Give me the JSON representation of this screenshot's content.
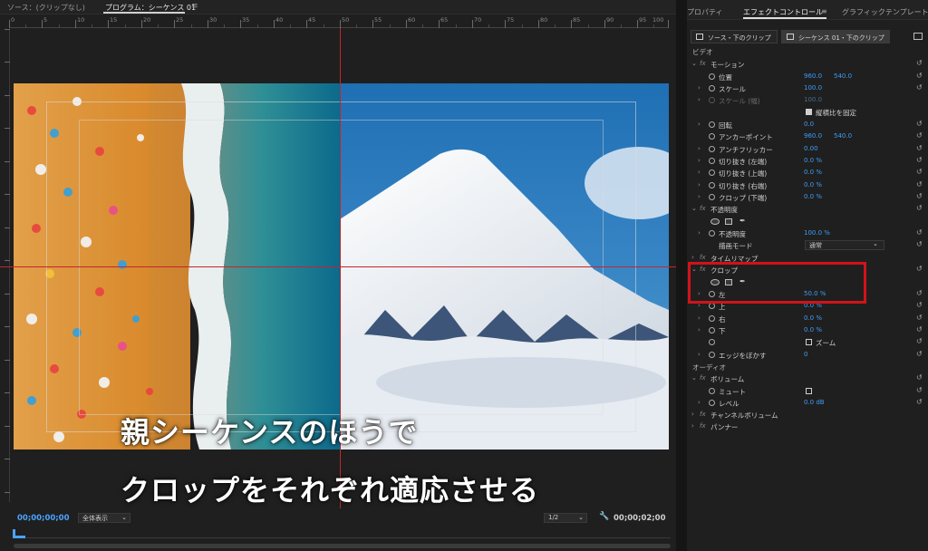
{
  "monitor": {
    "source_tab": "ソース：(クリップなし)",
    "program_tab": "プログラム：シーケンス 01",
    "menu_glyph": "≡",
    "ruler_labels": [
      "0",
      "5",
      "10",
      "15",
      "20",
      "25",
      "30",
      "35",
      "40",
      "45",
      "50",
      "55",
      "60",
      "65",
      "70",
      "75",
      "80",
      "85",
      "90",
      "95",
      "100"
    ],
    "caption_line1": "親シーケンスのほうで",
    "caption_line2": "クロップをそれぞれ適応させる",
    "timecode_left": "00;00;00;00",
    "fit_option": "全体表示",
    "resolution": "1/2",
    "timecode_right": "00;00;02;00"
  },
  "panel": {
    "tabs": [
      "プロパティ",
      "エフェクトコントロール",
      "グラフィックテンプレート"
    ],
    "tab_menu": "≡",
    "clip_source": "ソース・下のクリップ",
    "clip_sequence": "シーケンス 01・下のクリップ",
    "video_section": "ビデオ",
    "audio_section": "オーディオ",
    "motion": "モーション",
    "position": "位置",
    "position_x": "960.0",
    "position_y": "540.0",
    "scale": "スケール",
    "scale_value": "100.0",
    "scale_width": "スケール (幅)",
    "scale_width_value": "100.0",
    "uniform_scale": "縦横比を固定",
    "rotation": "回転",
    "rotation_value": "0.0",
    "anchor": "アンカーポイント",
    "anchor_x": "960.0",
    "anchor_y": "540.0",
    "antiflicker": "アンチフリッカー",
    "antiflicker_value": "0.00",
    "crop_left_motion": "切り抜き (左端)",
    "crop_left_motion_value": "0.0 %",
    "crop_top_motion": "切り抜き (上端)",
    "crop_top_motion_value": "0.0 %",
    "crop_right_motion": "切り抜き (右端)",
    "crop_right_motion_value": "0.0 %",
    "crop_bottom_motion": "クロップ (下端)",
    "crop_bottom_motion_value": "0.0 %",
    "opacity_effect": "不透明度",
    "opacity": "不透明度",
    "opacity_value": "100.0 %",
    "blend_mode": "描画モード",
    "blend_mode_value": "通常",
    "time_remap": "タイムリマップ",
    "crop_effect": "クロップ",
    "crop_left": "左",
    "crop_left_value": "50.0 %",
    "crop_top": "上",
    "crop_top_value": "0.0 %",
    "crop_right": "右",
    "crop_right_value": "0.0 %",
    "crop_bottom": "下",
    "crop_bottom_value": "0.0 %",
    "zoom": "ズーム",
    "edge_feather": "エッジをぼかす",
    "edge_feather_value": "0",
    "volume": "ボリューム",
    "mute": "ミュート",
    "level": "レベル",
    "level_value": "0.0 dB",
    "channel_volume": "チャンネルボリューム",
    "panner": "パンナー"
  },
  "colors": {
    "accent_blue": "#3f9df5",
    "guide_red": "#c1272d",
    "highlight_red": "#d1131a"
  }
}
